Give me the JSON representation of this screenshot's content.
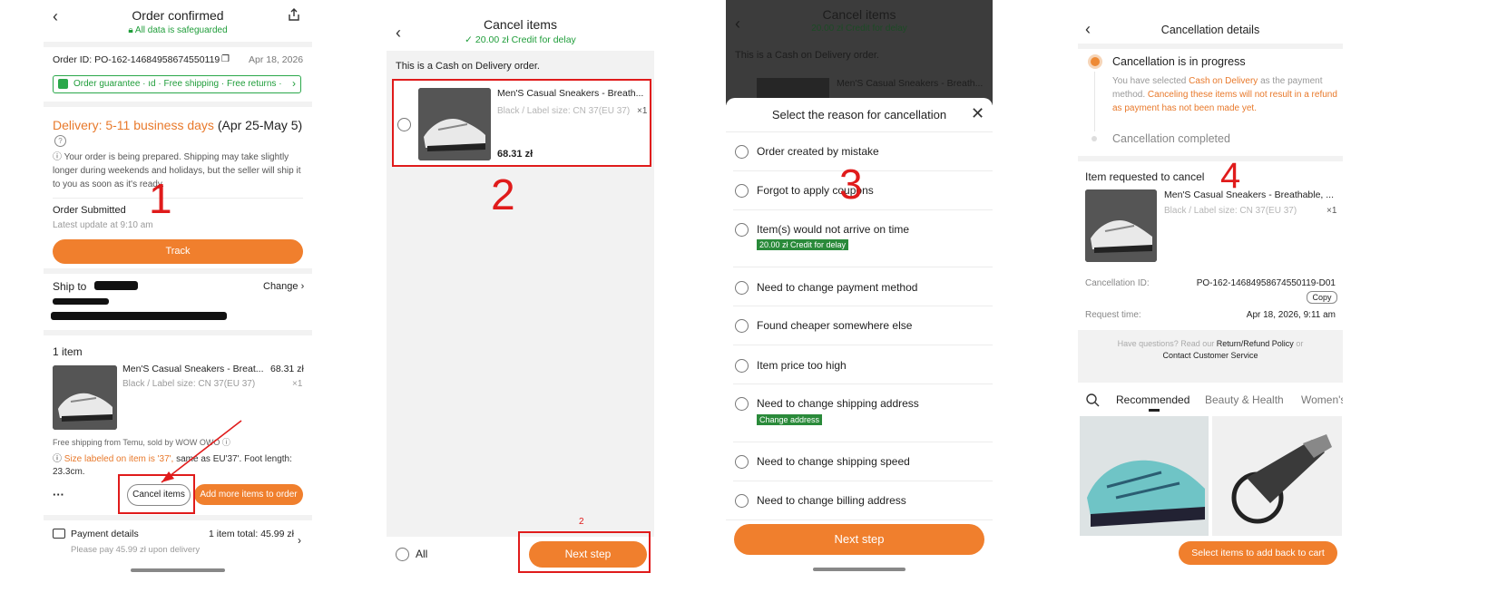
{
  "panel1": {
    "title": "Order confirmed",
    "safeguard": "All data is safeguarded",
    "order_id": "Order ID: PO-162-14684958674550119",
    "order_date": "Apr 18, 2026",
    "guarantee": "Order guarantee · ıd · Free shipping · Free returns ·",
    "delivery_label": "Delivery: 5-11 business days",
    "delivery_dates": "(Apr 25-May 5)",
    "prep_note": "Your order is being prepared. Shipping may take slightly longer during weekends and holidays, but the seller will ship it to you as soon as it's ready.",
    "status_title": "Order Submitted",
    "status_update": "Latest update at 9:10 am",
    "track_button": "Track",
    "ship_to": "Ship to",
    "change": "Change",
    "items_count": "1 item",
    "product_name": "Men'S Casual Sneakers - Breat...",
    "product_price": "68.31 zł",
    "product_variant": "Black / Label size: CN 37(EU 37)",
    "product_qty": "×1",
    "seller_note": "Free shipping from Temu, sold by WOW OWO",
    "size_note_orange": "Size labeled on item is '37',",
    "size_note_rest": "same as EU'37'. Foot length: 23.3cm.",
    "more": "···",
    "cancel_button": "Cancel items",
    "add_more_button": "Add more items to order",
    "payment_title": "Payment details",
    "payment_total": "1 item total: 45.99 zł",
    "payment_note": "Please pay 45.99 zł upon delivery",
    "annotation": "1"
  },
  "panel2": {
    "title": "Cancel items",
    "credit": "20.00 zł Credit for delay",
    "cod_note": "This is a Cash on Delivery order.",
    "product_name": "Men'S Casual Sneakers - Breath...",
    "product_variant": "Black / Label size: CN 37(EU 37)",
    "product_qty": "×1",
    "product_price": "68.31 zł",
    "all_label": "All",
    "next_button": "Next step",
    "annotation": "2",
    "annotation_small": "2"
  },
  "panel3": {
    "bg_title": "Cancel items",
    "bg_credit": "20.00 zł Credit for delay",
    "bg_cod": "This is a Cash on Delivery order.",
    "bg_product": "Men'S Casual Sneakers - Breath...",
    "sheet_title": "Select the reason for cancellation",
    "reasons": [
      {
        "label": "Order created by mistake",
        "tag": ""
      },
      {
        "label": "Forgot to apply coupons",
        "tag": ""
      },
      {
        "label": "Item(s) would not arrive on time",
        "tag": "20.00 zł Credit for delay"
      },
      {
        "label": "Need to change payment method",
        "tag": ""
      },
      {
        "label": "Found cheaper somewhere else",
        "tag": ""
      },
      {
        "label": "Item price too high",
        "tag": ""
      },
      {
        "label": "Need to change shipping address",
        "tag": "Change address"
      },
      {
        "label": "Need to change shipping speed",
        "tag": ""
      },
      {
        "label": "Need to change billing address",
        "tag": ""
      }
    ],
    "next_button": "Next step",
    "annotation": "3"
  },
  "panel4": {
    "title": "Cancellation details",
    "progress_title": "Cancellation is in progress",
    "progress_text_1": "You have selected",
    "progress_text_cod": "Cash on Delivery",
    "progress_text_2": "as the payment method.",
    "progress_text_orange": "Canceling these items will not result in a refund as payment has not been made yet.",
    "completed": "Cancellation completed",
    "requested_label": "Item requested to cancel",
    "product_name": "Men'S Casual Sneakers - Breathable, ...",
    "product_variant": "Black / Label size: CN 37(EU 37)",
    "product_qty": "×1",
    "cancel_id_label": "Cancellation ID:",
    "cancel_id_value": "PO-162-14684958674550119-D01",
    "copy": "Copy",
    "request_time_label": "Request time:",
    "request_time_value": "Apr 18, 2026, 9:11 am",
    "help_pre": "Have questions? Read our",
    "help_policy": "Return/Refund Policy",
    "help_or": "or",
    "help_contact": "Contact Customer Service",
    "tabs": [
      "Recommended",
      "Beauty & Health",
      "Women's"
    ],
    "cart_button": "Select items to add back to cart",
    "annotation": "4"
  }
}
